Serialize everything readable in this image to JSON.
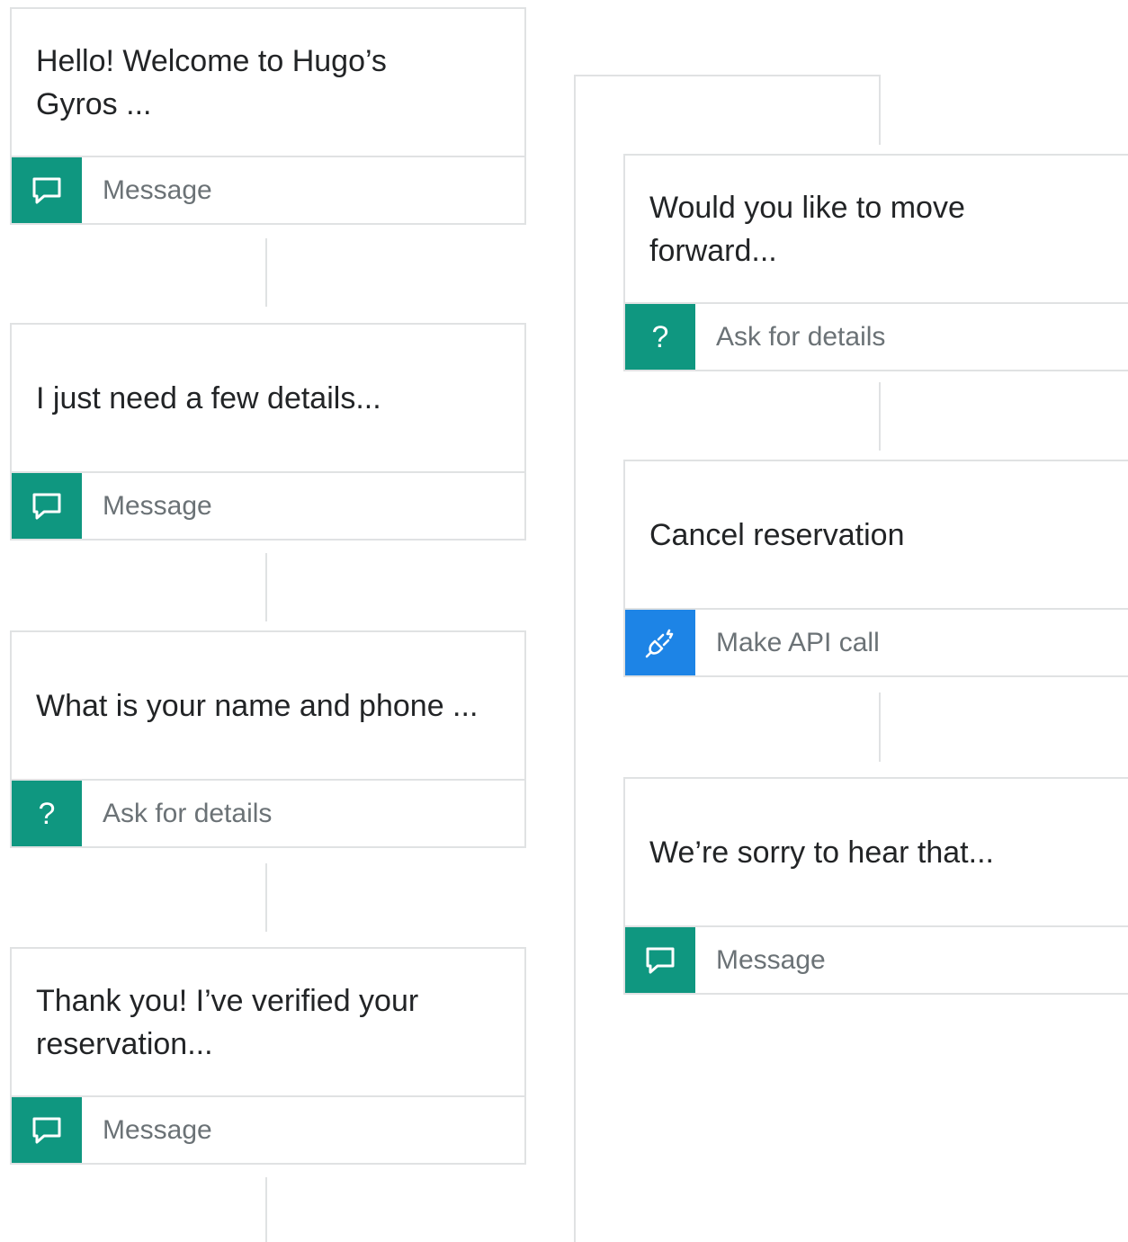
{
  "nodes": [
    {
      "text": "Hello! Welcome to Hugo’s\nGyros ...",
      "type": "Message",
      "icon": "chat-bubble-icon",
      "color": "#0f9780"
    },
    {
      "text": "I just need a few details...",
      "type": "Message",
      "icon": "chat-bubble-icon",
      "color": "#0f9780"
    },
    {
      "text": "What is your name and phone ...",
      "type": "Ask for details",
      "icon": "question-mark-icon",
      "color": "#0f9780"
    },
    {
      "text": "Thank you! I’ve verified your\nreservation...",
      "type": "Message",
      "icon": "chat-bubble-icon",
      "color": "#0f9780"
    },
    {
      "text": "Would you like to move\nforward...",
      "type": "Ask for details",
      "icon": "question-mark-icon",
      "color": "#0f9780"
    },
    {
      "text": "Cancel reservation",
      "type": "Make API call",
      "icon": "plug-icon",
      "color": "#1d84e6"
    },
    {
      "text": "We’re sorry to hear that...",
      "type": "Message",
      "icon": "chat-bubble-icon",
      "color": "#0f9780"
    }
  ],
  "icons": {
    "question_glyph": "?"
  }
}
